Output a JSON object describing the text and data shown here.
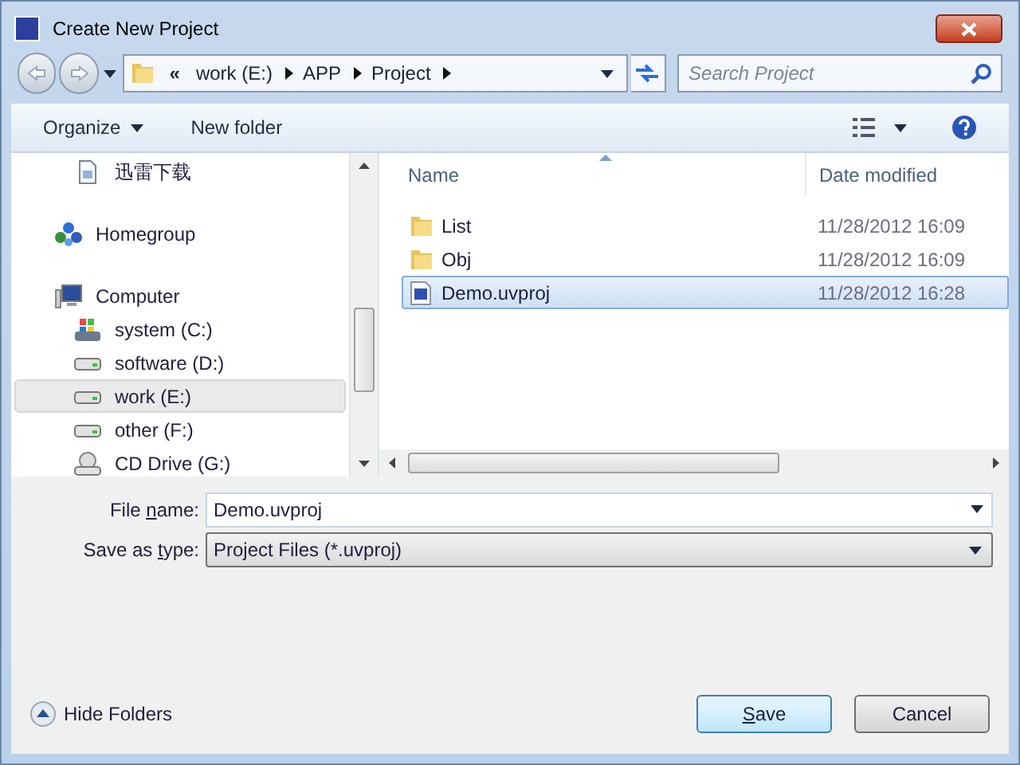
{
  "window": {
    "title": "Create New Project"
  },
  "address": {
    "overflow": "«",
    "crumbs": [
      "work (E:)",
      "APP",
      "Project"
    ]
  },
  "search": {
    "placeholder": "Search Project"
  },
  "toolbar": {
    "organize": "Organize",
    "new_folder": "New folder"
  },
  "nav": [
    {
      "label": "迅雷下载",
      "kind": "favorite",
      "selected": false
    },
    {
      "label": "Homegroup",
      "kind": "homegroup",
      "selected": false
    },
    {
      "label": "Computer",
      "kind": "computer",
      "selected": false,
      "children": [
        {
          "label": "system (C:)",
          "kind": "system-drive",
          "selected": false
        },
        {
          "label": "software (D:)",
          "kind": "drive",
          "selected": false
        },
        {
          "label": "work (E:)",
          "kind": "drive",
          "selected": true
        },
        {
          "label": "other (F:)",
          "kind": "drive",
          "selected": false
        },
        {
          "label": "CD Drive (G:)",
          "kind": "cd",
          "selected": false
        }
      ]
    }
  ],
  "columns": [
    "Name",
    "Date modified"
  ],
  "files": [
    {
      "name": "List",
      "date": "11/28/2012 16:09",
      "kind": "folder",
      "selected": false
    },
    {
      "name": "Obj",
      "date": "11/28/2012 16:09",
      "kind": "folder",
      "selected": false
    },
    {
      "name": "Demo.uvproj",
      "date": "11/28/2012 16:28",
      "kind": "project",
      "selected": true
    }
  ],
  "file_name": {
    "label": {
      "before": "File ",
      "key": "n",
      "after": "ame:"
    },
    "value": "Demo.uvproj"
  },
  "save_type": {
    "label": {
      "before": "Save as ",
      "key": "t",
      "after": "ype:"
    },
    "value": "Project Files (*.uvproj)"
  },
  "hide_folders": "Hide Folders",
  "buttons": [
    {
      "label": {
        "key": "S",
        "after": "ave"
      },
      "default": true
    },
    {
      "label": {
        "before": "Cancel"
      },
      "default": false
    }
  ]
}
